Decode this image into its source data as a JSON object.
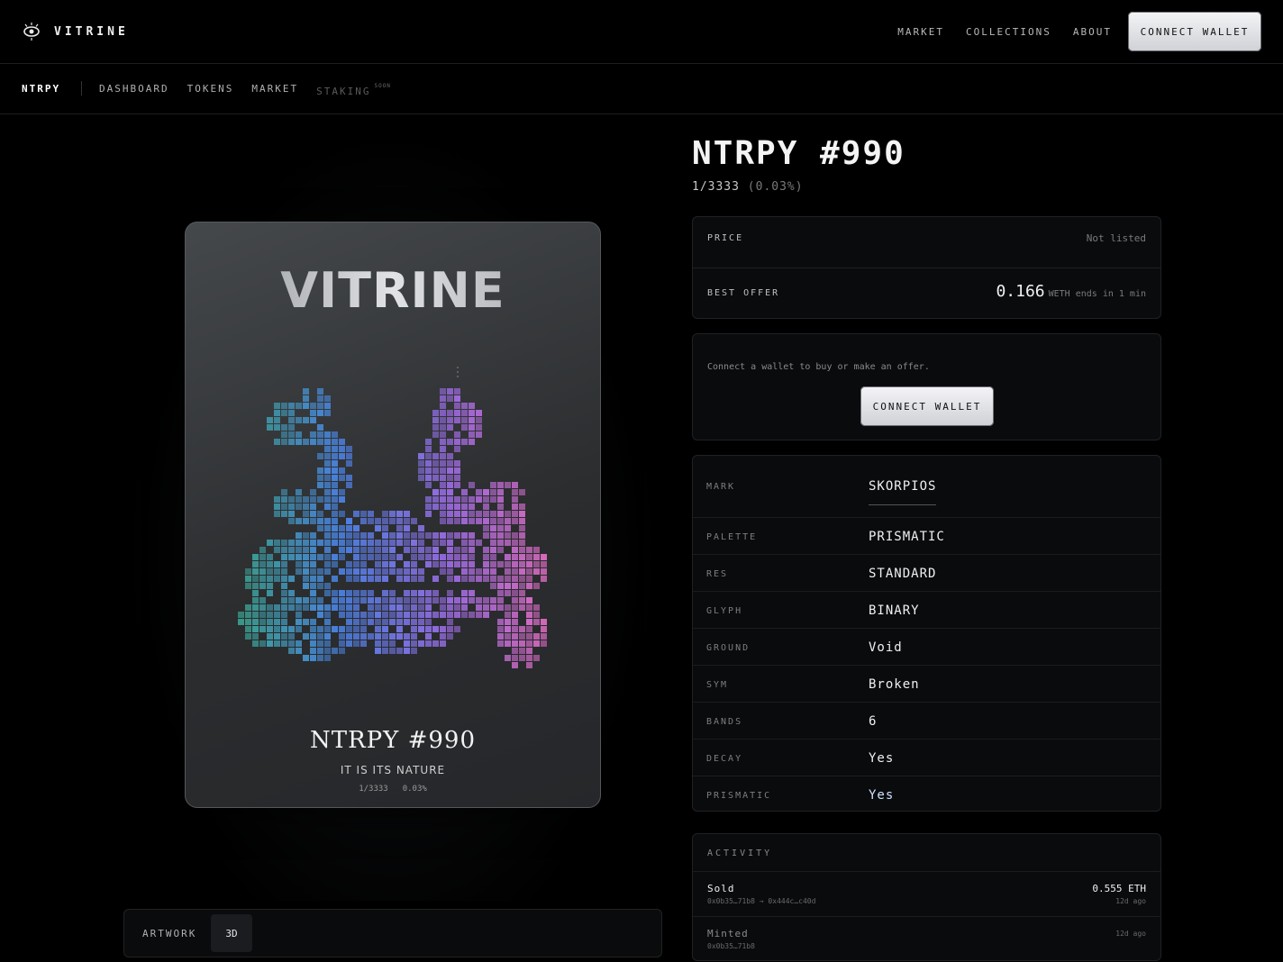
{
  "header": {
    "brand": "VITRINE",
    "nav": [
      "MARKET",
      "COLLECTIONS",
      "ABOUT"
    ],
    "connect_label": "CONNECT WALLET"
  },
  "subnav": {
    "brand": "NTRPY",
    "items": [
      "DASHBOARD",
      "TOKENS",
      "MARKET"
    ],
    "staking": "STAKING",
    "soon": "SOON"
  },
  "card": {
    "logo": "VITRINE",
    "title": "NTRPY #990",
    "subtitle": "IT IS ITS NATURE",
    "rank": "1/3333",
    "pct": "0.03%"
  },
  "view": {
    "artwork": "ARTWORK",
    "three_d": "3D"
  },
  "token": {
    "title": "NTRPY #990",
    "rank": "1/3333",
    "pct": "(0.03%)"
  },
  "pricing": {
    "price_label": "PRICE",
    "price_value": "Not listed",
    "offer_label": "BEST OFFER",
    "offer_amount": "0.166",
    "offer_unit": "WETH",
    "offer_ends": "ends in 1 min"
  },
  "wallet": {
    "message": "Connect a wallet to buy or make an offer.",
    "button": "CONNECT WALLET"
  },
  "traits": [
    {
      "key": "MARK",
      "value": "SKORPIOS"
    },
    {
      "key": "PALETTE",
      "value": "PRISMATIC"
    },
    {
      "key": "RES",
      "value": "STANDARD"
    },
    {
      "key": "GLYPH",
      "value": "BINARY"
    },
    {
      "key": "GROUND",
      "value": "Void"
    },
    {
      "key": "SYM",
      "value": "Broken"
    },
    {
      "key": "BANDS",
      "value": "6"
    },
    {
      "key": "DECAY",
      "value": "Yes"
    },
    {
      "key": "PRISMATIC",
      "value": "Yes"
    }
  ],
  "activity": {
    "heading": "ACTIVITY",
    "rows": [
      {
        "type": "Sold",
        "addr": "0x0b35…71b8 → 0x444c…c40d",
        "amount": "0.555 ETH",
        "time": "12d ago"
      },
      {
        "type": "Minted",
        "addr": "0x0b35…71b8",
        "amount": "",
        "time": "12d ago"
      }
    ]
  },
  "colors": {
    "background": "#000000",
    "teal": "#3aa58a",
    "blue": "#4a7fe0",
    "violet": "#9a6ae0",
    "pink": "#e06ab8"
  }
}
